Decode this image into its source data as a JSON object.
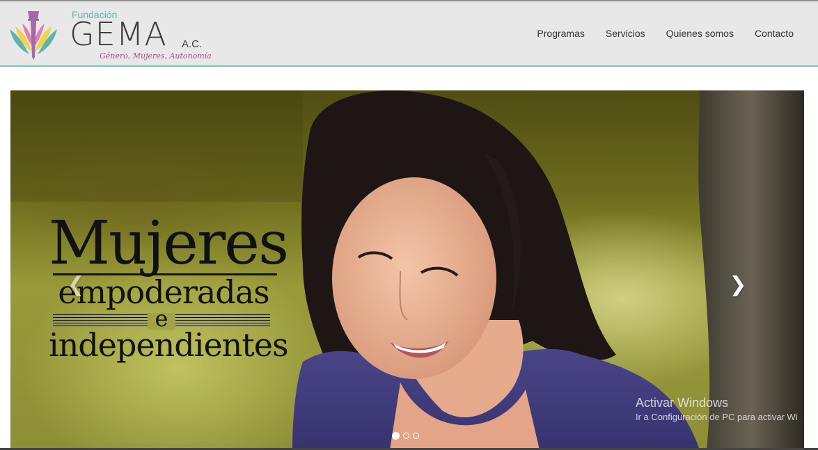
{
  "brand": {
    "pre_name": "Fundación",
    "name": "GEMA",
    "suffix": "A.C.",
    "tagline": "Género, Mujeres, Autonomía"
  },
  "nav": {
    "items": [
      {
        "label": "Programas"
      },
      {
        "label": "Servicios"
      },
      {
        "label": "Quienes somos"
      },
      {
        "label": "Contacto"
      }
    ]
  },
  "carousel": {
    "headline_line1": "Mujeres",
    "headline_line2": "empoderadas",
    "headline_connector": "e",
    "headline_line3": "independientes",
    "prev_icon": "chevron-left-icon",
    "next_icon": "chevron-right-icon",
    "slide_count": 3,
    "active_slide": 1
  },
  "os_watermark": {
    "title": "Activar Windows",
    "subtitle": "Ir a Configuración de PC para activar Wi"
  },
  "colors": {
    "header_bg": "#e8e8e8",
    "header_border": "#7fc4c0",
    "brand_teal": "#5cb5a8",
    "brand_magenta": "#b3449a",
    "brand_yellow": "#f2d24a",
    "brand_purple": "#a26aa6",
    "text_dark": "#333333"
  }
}
